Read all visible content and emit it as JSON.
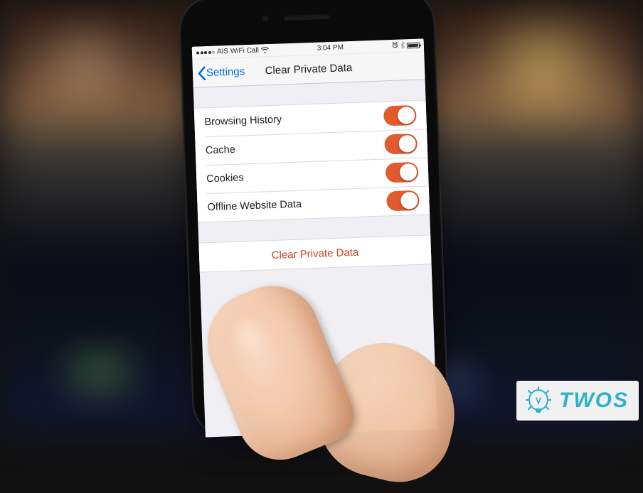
{
  "status_bar": {
    "carrier": "AIS WiFi Call",
    "time": "3:04 PM"
  },
  "nav": {
    "back_label": "Settings",
    "title": "Clear Private Data"
  },
  "options": [
    {
      "label": "Browsing History",
      "on": true
    },
    {
      "label": "Cache",
      "on": true
    },
    {
      "label": "Cookies",
      "on": true
    },
    {
      "label": "Offline Website Data",
      "on": true
    }
  ],
  "action": {
    "clear_label": "Clear Private Data"
  },
  "watermark": {
    "text": "TWOS"
  }
}
